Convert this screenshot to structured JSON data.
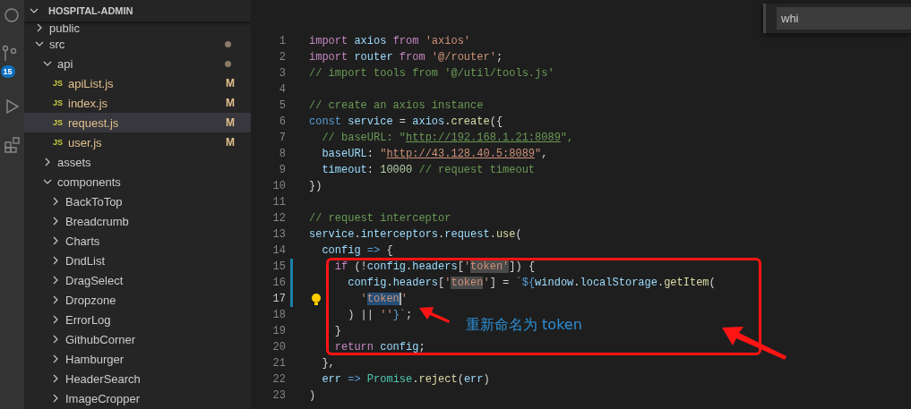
{
  "activity_bar": {
    "badge": "15"
  },
  "explorer": {
    "title": "HOSPITAL-ADMIN",
    "tree": [
      {
        "name": "public",
        "kind": "folder",
        "expanded": false,
        "modified": false
      },
      {
        "name": "src",
        "kind": "folder",
        "expanded": true,
        "modified": true,
        "children": [
          {
            "name": "api",
            "kind": "folder",
            "expanded": true,
            "modified": true,
            "children": [
              {
                "name": "apiList.js",
                "kind": "file",
                "icon": "JS",
                "status": "M",
                "selected": false
              },
              {
                "name": "index.js",
                "kind": "file",
                "icon": "JS",
                "status": "M",
                "selected": false
              },
              {
                "name": "request.js",
                "kind": "file",
                "icon": "JS",
                "status": "M",
                "selected": true
              },
              {
                "name": "user.js",
                "kind": "file",
                "icon": "JS",
                "status": "M",
                "selected": false
              }
            ]
          },
          {
            "name": "assets",
            "kind": "folder",
            "expanded": false,
            "modified": false
          },
          {
            "name": "components",
            "kind": "folder",
            "expanded": true,
            "modified": false,
            "children": [
              {
                "name": "BackToTop",
                "kind": "folder",
                "expanded": false,
                "modified": false
              },
              {
                "name": "Breadcrumb",
                "kind": "folder",
                "expanded": false,
                "modified": false
              },
              {
                "name": "Charts",
                "kind": "folder",
                "expanded": false,
                "modified": false
              },
              {
                "name": "DndList",
                "kind": "folder",
                "expanded": false,
                "modified": false
              },
              {
                "name": "DragSelect",
                "kind": "folder",
                "expanded": false,
                "modified": false
              },
              {
                "name": "Dropzone",
                "kind": "folder",
                "expanded": false,
                "modified": false
              },
              {
                "name": "ErrorLog",
                "kind": "folder",
                "expanded": false,
                "modified": false
              },
              {
                "name": "GithubCorner",
                "kind": "folder",
                "expanded": false,
                "modified": false
              },
              {
                "name": "Hamburger",
                "kind": "folder",
                "expanded": false,
                "modified": false
              },
              {
                "name": "HeaderSearch",
                "kind": "folder",
                "expanded": false,
                "modified": false
              },
              {
                "name": "ImageCropper",
                "kind": "folder",
                "expanded": false,
                "modified": false
              }
            ]
          }
        ]
      }
    ]
  },
  "find_widget": {
    "value": "whi"
  },
  "editor": {
    "lines": [
      {
        "number": "1",
        "current": false,
        "changed": false,
        "lightbulb": false,
        "tokens": [
          {
            "kind": "keyword",
            "text": "import "
          },
          {
            "kind": "variable",
            "text": "axios "
          },
          {
            "kind": "keyword",
            "text": "from "
          },
          {
            "kind": "string",
            "text": "'axios'"
          }
        ]
      },
      {
        "number": "2",
        "current": false,
        "changed": false,
        "lightbulb": false,
        "tokens": [
          {
            "kind": "keyword",
            "text": "import "
          },
          {
            "kind": "variable",
            "text": "router "
          },
          {
            "kind": "keyword",
            "text": "from "
          },
          {
            "kind": "string",
            "text": "'@/router'"
          },
          {
            "kind": "plain",
            "text": ";"
          }
        ]
      },
      {
        "number": "3",
        "current": false,
        "changed": false,
        "lightbulb": false,
        "tokens": [
          {
            "kind": "comment",
            "text": "// import tools from '@/util/tools.js'"
          }
        ]
      },
      {
        "number": "4",
        "current": false,
        "changed": false,
        "lightbulb": false
      },
      {
        "number": "5",
        "current": false,
        "changed": false,
        "lightbulb": false,
        "tokens": [
          {
            "kind": "comment",
            "text": "// create an axios instance"
          }
        ]
      },
      {
        "number": "6",
        "current": false,
        "changed": false,
        "lightbulb": false,
        "tokens": [
          {
            "kind": "storage",
            "text": "const "
          },
          {
            "kind": "variable",
            "text": "service"
          },
          {
            "kind": "plain",
            "text": " = "
          },
          {
            "kind": "variable",
            "text": "axios"
          },
          {
            "kind": "plain",
            "text": "."
          },
          {
            "kind": "function",
            "text": "create"
          },
          {
            "kind": "plain",
            "text": "({"
          }
        ]
      },
      {
        "number": "7",
        "current": false,
        "changed": false,
        "lightbulb": false,
        "tokens": [
          {
            "kind": "comment",
            "text": "  // baseURL: \""
          },
          {
            "kind": "comment_link",
            "text": "http://192.168.1.21:8089"
          },
          {
            "kind": "comment",
            "text": "\","
          }
        ]
      },
      {
        "number": "8",
        "current": false,
        "changed": false,
        "lightbulb": false,
        "tokens": [
          {
            "kind": "variable",
            "text": "  baseURL"
          },
          {
            "kind": "plain",
            "text": ": "
          },
          {
            "kind": "string",
            "text": "\""
          },
          {
            "kind": "string_link",
            "text": "http://43.128.40.5:8089"
          },
          {
            "kind": "string",
            "text": "\""
          },
          {
            "kind": "plain",
            "text": ","
          }
        ]
      },
      {
        "number": "9",
        "current": false,
        "changed": false,
        "lightbulb": false,
        "tokens": [
          {
            "kind": "variable",
            "text": "  timeout"
          },
          {
            "kind": "plain",
            "text": ": "
          },
          {
            "kind": "number",
            "text": "10000 "
          },
          {
            "kind": "comment",
            "text": "// request timeout"
          }
        ]
      },
      {
        "number": "10",
        "current": false,
        "changed": false,
        "lightbulb": false,
        "tokens": [
          {
            "kind": "plain",
            "text": "})"
          }
        ]
      },
      {
        "number": "11",
        "current": false,
        "changed": false,
        "lightbulb": false
      },
      {
        "number": "12",
        "current": false,
        "changed": false,
        "lightbulb": false,
        "tokens": [
          {
            "kind": "comment",
            "text": "// request interceptor"
          }
        ]
      },
      {
        "number": "13",
        "current": false,
        "changed": false,
        "lightbulb": false,
        "tokens": [
          {
            "kind": "variable",
            "text": "service"
          },
          {
            "kind": "plain",
            "text": "."
          },
          {
            "kind": "variable",
            "text": "interceptors"
          },
          {
            "kind": "plain",
            "text": "."
          },
          {
            "kind": "variable",
            "text": "request"
          },
          {
            "kind": "plain",
            "text": "."
          },
          {
            "kind": "function",
            "text": "use"
          },
          {
            "kind": "plain",
            "text": "("
          }
        ]
      },
      {
        "number": "14",
        "current": false,
        "changed": false,
        "lightbulb": false,
        "tokens": [
          {
            "kind": "variable",
            "text": "  config "
          },
          {
            "kind": "storage",
            "text": "=>"
          },
          {
            "kind": "plain",
            "text": " {"
          }
        ]
      },
      {
        "number": "15",
        "current": false,
        "changed": true,
        "lightbulb": false,
        "tokens": [
          {
            "kind": "keyword",
            "text": "    if"
          },
          {
            "kind": "plain",
            "text": " (!"
          },
          {
            "kind": "variable",
            "text": "config"
          },
          {
            "kind": "plain",
            "text": "."
          },
          {
            "kind": "variable",
            "text": "headers"
          },
          {
            "kind": "plain",
            "text": "["
          },
          {
            "kind": "string",
            "text": "'"
          },
          {
            "kind": "string_highlight",
            "text": "token'"
          },
          {
            "kind": "plain",
            "text": "]) {"
          }
        ]
      },
      {
        "number": "16",
        "current": false,
        "changed": true,
        "lightbulb": false,
        "tokens": [
          {
            "kind": "variable",
            "text": "      config"
          },
          {
            "kind": "plain",
            "text": "."
          },
          {
            "kind": "variable",
            "text": "headers"
          },
          {
            "kind": "plain",
            "text": "["
          },
          {
            "kind": "string",
            "text": "'"
          },
          {
            "kind": "string_highlight",
            "text": "token"
          },
          {
            "kind": "string",
            "text": "'"
          },
          {
            "kind": "plain",
            "text": "] = "
          },
          {
            "kind": "string",
            "text": "`"
          },
          {
            "kind": "storage",
            "text": "${"
          },
          {
            "kind": "variable",
            "text": "window"
          },
          {
            "kind": "plain",
            "text": "."
          },
          {
            "kind": "variable",
            "text": "localStorage"
          },
          {
            "kind": "plain",
            "text": "."
          },
          {
            "kind": "function",
            "text": "getItem"
          },
          {
            "kind": "plain",
            "text": "("
          }
        ]
      },
      {
        "number": "17",
        "current": true,
        "changed": true,
        "lightbulb": true,
        "tokens": [
          {
            "kind": "string",
            "text": "        '"
          },
          {
            "kind": "string_selection",
            "text": "token"
          },
          {
            "kind": "string",
            "text": "'"
          }
        ]
      },
      {
        "number": "18",
        "current": false,
        "changed": false,
        "lightbulb": false,
        "tokens": [
          {
            "kind": "plain",
            "text": "      ) || "
          },
          {
            "kind": "string",
            "text": "''"
          },
          {
            "kind": "storage",
            "text": "}"
          },
          {
            "kind": "string",
            "text": "`"
          },
          {
            "kind": "plain",
            "text": ";"
          }
        ]
      },
      {
        "number": "19",
        "current": false,
        "changed": false,
        "lightbulb": false,
        "tokens": [
          {
            "kind": "plain",
            "text": "    }"
          }
        ]
      },
      {
        "number": "20",
        "current": false,
        "changed": false,
        "lightbulb": false,
        "tokens": [
          {
            "kind": "keyword",
            "text": "    return "
          },
          {
            "kind": "variable",
            "text": "config"
          },
          {
            "kind": "plain",
            "text": ";"
          }
        ]
      },
      {
        "number": "21",
        "current": false,
        "changed": false,
        "lightbulb": false,
        "tokens": [
          {
            "kind": "plain",
            "text": "  },"
          }
        ]
      },
      {
        "number": "22",
        "current": false,
        "changed": false,
        "lightbulb": false,
        "tokens": [
          {
            "kind": "variable",
            "text": "  err "
          },
          {
            "kind": "storage",
            "text": "=> "
          },
          {
            "kind": "class",
            "text": "Promise"
          },
          {
            "kind": "plain",
            "text": "."
          },
          {
            "kind": "function",
            "text": "reject"
          },
          {
            "kind": "plain",
            "text": "("
          },
          {
            "kind": "variable",
            "text": "err"
          },
          {
            "kind": "plain",
            "text": ")"
          }
        ]
      },
      {
        "number": "23",
        "current": false,
        "changed": false,
        "lightbulb": false,
        "tokens": [
          {
            "kind": "plain",
            "text": ")"
          }
        ]
      }
    ]
  },
  "annotation": {
    "text": "重新命名为 token"
  }
}
